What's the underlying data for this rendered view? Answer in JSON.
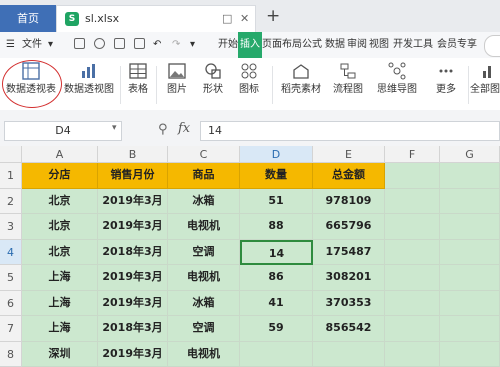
{
  "titlebar": {
    "home_tab": "首页",
    "file_tab": "sl.xlsx",
    "file_icon_glyph": "S",
    "new_tab": "+"
  },
  "menubar": {
    "file_menu": "文件",
    "items": [
      "开始",
      "插入",
      "页面布局",
      "公式",
      "数据",
      "审阅",
      "视图",
      "开发工具",
      "会员专享"
    ],
    "active_item": "插入"
  },
  "ribbon": {
    "items": [
      {
        "label": "数据透视表",
        "icon": "pivot-table-icon"
      },
      {
        "label": "数据透视图",
        "icon": "pivot-chart-icon"
      },
      {
        "label": "表格",
        "icon": "table-icon"
      },
      {
        "label": "图片",
        "icon": "picture-icon"
      },
      {
        "label": "形状",
        "icon": "shape-icon"
      },
      {
        "label": "图标",
        "icon": "icons-icon"
      },
      {
        "label": "稻壳素材",
        "icon": "material-icon"
      },
      {
        "label": "流程图",
        "icon": "flowchart-icon"
      },
      {
        "label": "思维导图",
        "icon": "mindmap-icon"
      },
      {
        "label": "更多",
        "icon": "more-icon"
      },
      {
        "label": "全部图",
        "icon": "all-charts-icon"
      }
    ],
    "highlight_color": "#d32f2f"
  },
  "formula": {
    "cell_ref": "D4",
    "fx": "fx",
    "value": "14"
  },
  "sheet": {
    "columns": [
      "A",
      "B",
      "C",
      "D",
      "E",
      "F",
      "G"
    ],
    "row_numbers": [
      "1",
      "2",
      "3",
      "4",
      "5",
      "6",
      "7",
      "8"
    ],
    "selected_column": "D",
    "selected_row": "4",
    "headers": [
      "分店",
      "销售月份",
      "商品",
      "数量",
      "总金额"
    ],
    "rows": [
      [
        "北京",
        "2019年3月",
        "冰箱",
        "51",
        "978109"
      ],
      [
        "北京",
        "2019年3月",
        "电视机",
        "88",
        "665796"
      ],
      [
        "北京",
        "2018年3月",
        "空调",
        "14",
        "175487"
      ],
      [
        "上海",
        "2019年3月",
        "电视机",
        "86",
        "308201"
      ],
      [
        "上海",
        "2019年3月",
        "冰箱",
        "41",
        "370353"
      ],
      [
        "上海",
        "2018年3月",
        "空调",
        "59",
        "856542"
      ],
      [
        "深圳",
        "2019年3月",
        "电视机",
        "",
        ""
      ]
    ],
    "header_color": "#f5b800",
    "body_color": "#cce8cf"
  }
}
